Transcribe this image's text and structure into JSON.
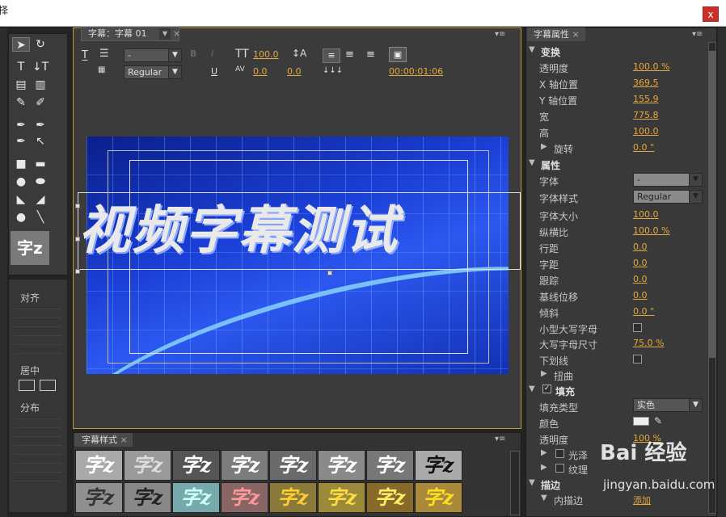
{
  "window": {
    "title_fragment": "择",
    "close_label": "x"
  },
  "title_panel": {
    "tab_label": "字幕：字幕 01",
    "font_dropdown": "-",
    "style_dropdown": "Regular",
    "font_size": "100.0",
    "kerning": "0.0",
    "leading": "0.0",
    "tracking": "0.0",
    "timecode": "00:00:01:06",
    "title_text": "视频字幕测试"
  },
  "tools": {
    "preview_label": "字z"
  },
  "align_panel": {
    "align_label": "对齐",
    "center_label": "居中",
    "distribute_label": "分布"
  },
  "styles_panel": {
    "tab_label": "字幕样式",
    "samples": [
      "字z",
      "字z",
      "字z",
      "字z",
      "字z",
      "字z",
      "字z",
      "字z",
      "字z",
      "字z",
      "字z",
      "字z",
      "字z",
      "字z",
      "字z",
      "字z"
    ]
  },
  "props_panel": {
    "tab_label": "字幕属性",
    "transform_label": "变换",
    "opacity_label": "透明度",
    "opacity_value": "100.0 %",
    "x_label": "X 轴位置",
    "x_value": "369.5",
    "y_label": "Y 轴位置",
    "y_value": "155.9",
    "width_label": "宽",
    "width_value": "775.8",
    "height_label": "高",
    "height_value": "100.0",
    "rotation_label": "旋转",
    "rotation_value": "0.0 °",
    "properties_label": "属性",
    "font_label": "字体",
    "font_value": "-",
    "font_style_label": "字体样式",
    "font_style_value": "Regular",
    "font_size_label": "字体大小",
    "font_size_value": "100.0",
    "aspect_label": "纵横比",
    "aspect_value": "100.0 %",
    "leading_label": "行距",
    "leading_value": "0.0",
    "kerning_label": "字距",
    "kerning_value": "0.0",
    "tracking_label": "跟踪",
    "tracking_value": "0.0",
    "baseline_label": "基线位移",
    "baseline_value": "0.0",
    "slant_label": "倾斜",
    "slant_value": "0.0 °",
    "small_caps_label": "小型大写字母",
    "small_caps_size_label": "大写字母尺寸",
    "small_caps_size_value": "75.0 %",
    "underline_label": "下划线",
    "distort_label": "扭曲",
    "fill_label": "填充",
    "fill_type_label": "填充类型",
    "fill_type_value": "实色",
    "color_label": "颜色",
    "fill_opacity_label": "透明度",
    "fill_opacity_value": "100 %",
    "sheen_label": "光泽",
    "texture_label": "纹理",
    "stroke_label": "描边",
    "inner_stroke_label": "内描边",
    "add_label": "添加"
  },
  "watermark": {
    "main": "Bai 经验",
    "sub": "jingyan.baidu.com"
  }
}
